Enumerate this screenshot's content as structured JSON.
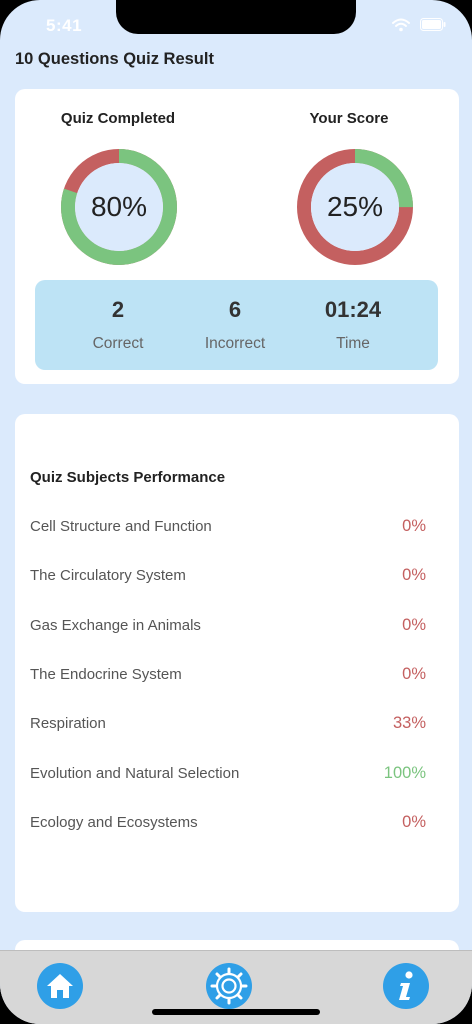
{
  "status_bar": {
    "time": "5:41"
  },
  "page_title": "10 Questions Quiz Result",
  "summary": {
    "completed": {
      "title": "Quiz Completed",
      "label": "80%",
      "fraction": 0.8
    },
    "score": {
      "title": "Your Score",
      "label": "25%",
      "fraction": 0.25
    },
    "stats": [
      {
        "value": "2",
        "label": "Correct"
      },
      {
        "value": "6",
        "label": "Incorrect"
      },
      {
        "value": "01:24",
        "label": "Time"
      }
    ]
  },
  "performance": {
    "title": "Quiz Subjects Performance",
    "rows": [
      {
        "name": "Cell Structure and Function",
        "pct": "0%",
        "status": "bad"
      },
      {
        "name": "The Circulatory System",
        "pct": "0%",
        "status": "bad"
      },
      {
        "name": "Gas Exchange in Animals",
        "pct": "0%",
        "status": "bad"
      },
      {
        "name": "The Endocrine System",
        "pct": "0%",
        "status": "bad"
      },
      {
        "name": "Respiration",
        "pct": "33%",
        "status": "bad"
      },
      {
        "name": "Evolution and Natural Selection",
        "pct": "100%",
        "status": "good"
      },
      {
        "name": "Ecology and Ecosystems",
        "pct": "0%",
        "status": "bad"
      }
    ]
  },
  "tabbar": {
    "items": [
      "home-icon",
      "settings-gear-icon",
      "info-icon"
    ]
  },
  "colors": {
    "good": "#7bc47f",
    "bad": "#c46060",
    "accent": "#2f9fe7",
    "background": "#dbeafc",
    "stats_box": "#bde3f5"
  }
}
